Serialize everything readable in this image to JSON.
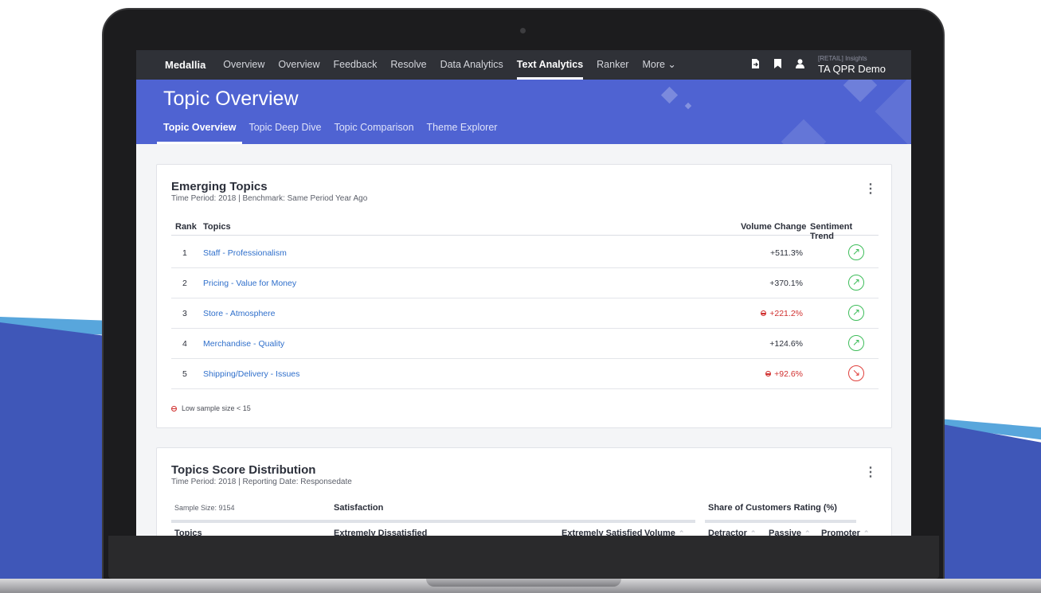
{
  "nav": {
    "brand": "Medallia",
    "items": [
      "Overview",
      "Overview",
      "Feedback",
      "Resolve",
      "Data Analytics",
      "Text Analytics",
      "Ranker",
      "More ⌄"
    ],
    "active_index": 5,
    "icons": [
      "export-icon",
      "bookmark-icon",
      "user-icon"
    ],
    "user_small": "[RETAIL] Insights",
    "user_name": "TA QPR Demo"
  },
  "header": {
    "title": "Topic Overview",
    "tabs": [
      "Topic Overview",
      "Topic Deep Dive",
      "Topic Comparison",
      "Theme Explorer"
    ],
    "active_tab": 0
  },
  "emerging": {
    "title": "Emerging Topics",
    "subtitle": "Time Period: 2018 | Benchmark: Same Period Year Ago",
    "columns": {
      "rank": "Rank",
      "topics": "Topics",
      "volume": "Volume Change",
      "sentiment": "Sentiment Trend"
    },
    "rows": [
      {
        "rank": "1",
        "topic": "Staff - Professionalism",
        "volume": "+511.3%",
        "low_sample": false,
        "trend": "up"
      },
      {
        "rank": "2",
        "topic": "Pricing - Value for Money",
        "volume": "+370.1%",
        "low_sample": false,
        "trend": "up"
      },
      {
        "rank": "3",
        "topic": "Store - Atmosphere",
        "volume": "+221.2%",
        "low_sample": true,
        "trend": "up"
      },
      {
        "rank": "4",
        "topic": "Merchandise - Quality",
        "volume": "+124.6%",
        "low_sample": false,
        "trend": "up"
      },
      {
        "rank": "5",
        "topic": "Shipping/Delivery - Issues",
        "volume": "+92.6%",
        "low_sample": true,
        "trend": "down"
      }
    ],
    "note": "Low sample size < 15"
  },
  "distribution": {
    "title": "Topics Score Distribution",
    "subtitle": "Time Period: 2018 | Reporting Date: Responsedate",
    "sample": "Sample Size: 9154",
    "satisfaction": "Satisfaction",
    "share": "Share of Customers Rating (%)",
    "columns": [
      "Topics",
      "Extremely Dissatisfied",
      "Extremely Satisfied",
      "Volume",
      "Detractor",
      "Passive",
      "Promoter"
    ]
  },
  "colors": {
    "nav_bg": "#2f3137",
    "header_bg": "#4f63d2",
    "link": "#2f6fcb",
    "trend_up": "#3ebd5a",
    "trend_down": "#e0403c",
    "warning": "#d0302f"
  }
}
